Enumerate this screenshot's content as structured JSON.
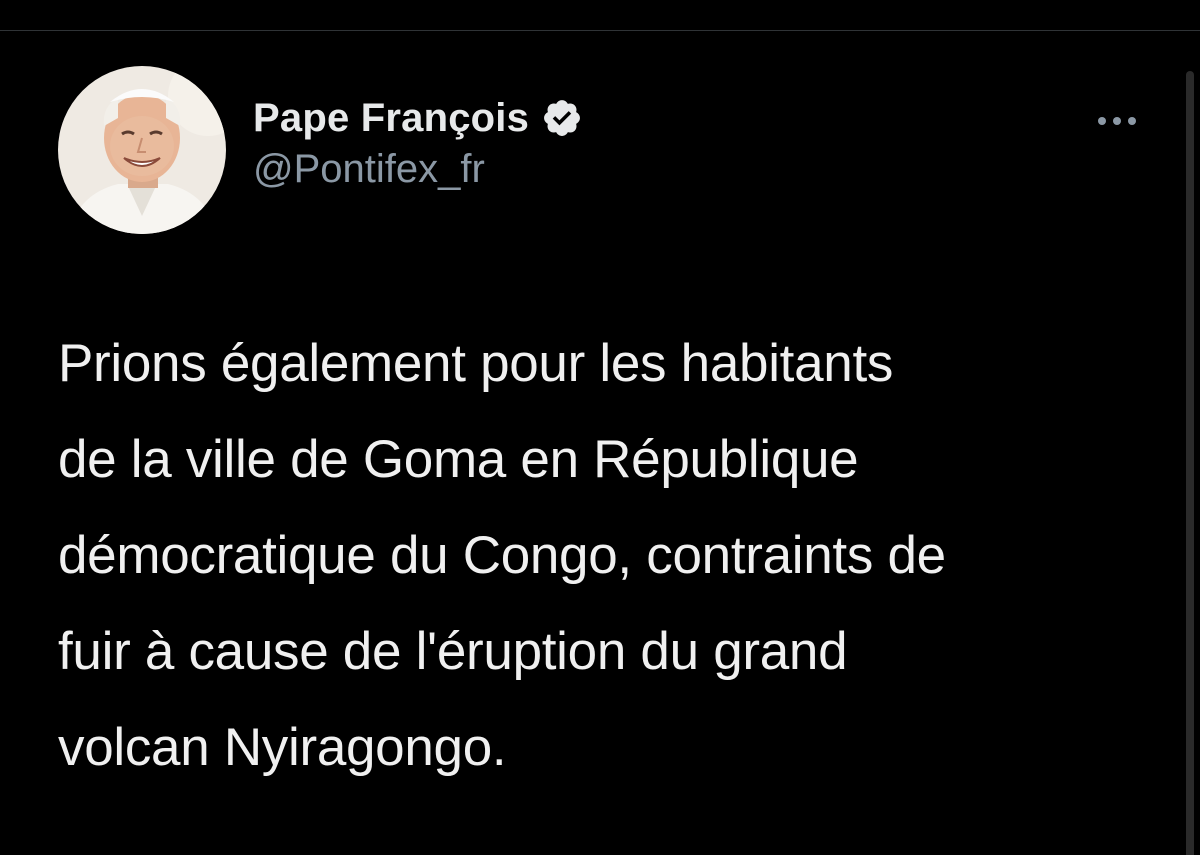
{
  "tweet": {
    "author": {
      "display_name": "Pape François",
      "handle": "@Pontifex_fr",
      "verified": true,
      "avatar_icon": "avatar-portrait",
      "verified_icon": "verified-badge-icon"
    },
    "more_icon": "more-options-icon",
    "text": "Prions également pour les habitants\nde la ville de Goma en République\ndémocratique du Congo, contraints de\nfuir à cause de l'éruption du grand\nvolcan Nyiragongo."
  },
  "colors": {
    "background": "#000000",
    "primary_text": "#e7e9ea",
    "secondary_text": "#8b98a5",
    "divider": "#2f3336"
  }
}
